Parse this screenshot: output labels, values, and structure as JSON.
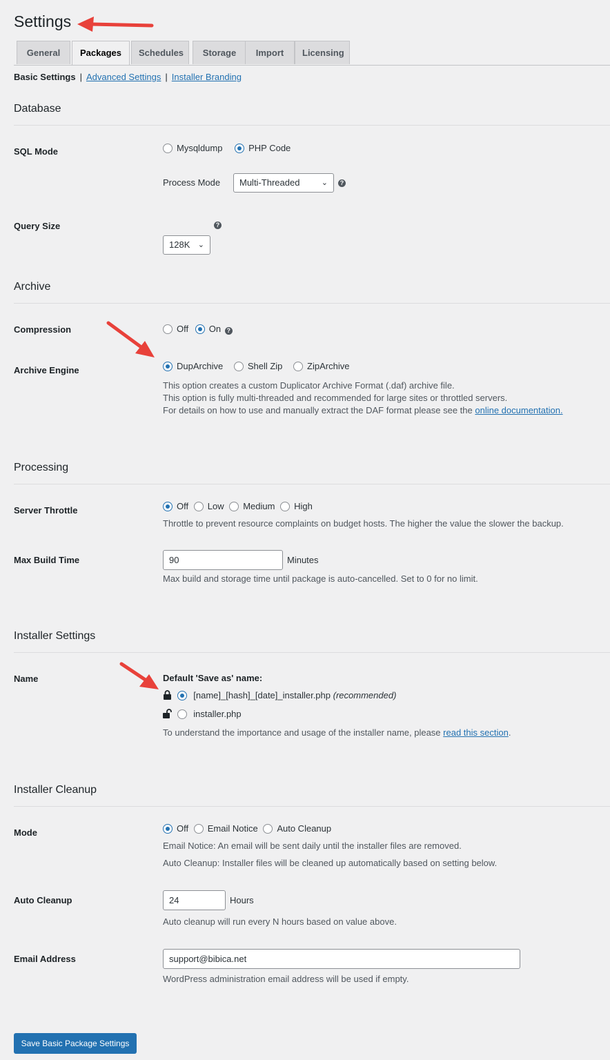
{
  "page_title": "Settings",
  "tabs": [
    {
      "label": "General"
    },
    {
      "label": "Packages"
    },
    {
      "label": "Schedules"
    },
    {
      "label": "Storage"
    },
    {
      "label": "Import"
    },
    {
      "label": "Licensing"
    }
  ],
  "subnav": {
    "current": "Basic Settings",
    "advanced": "Advanced Settings",
    "branding": "Installer Branding",
    "separator": "|"
  },
  "database": {
    "title": "Database",
    "sql_mode_label": "SQL Mode",
    "sql_mode_options": [
      "Mysqldump",
      "PHP Code"
    ],
    "process_mode_label": "Process Mode",
    "process_mode_value": "Multi-Threaded",
    "query_size_label": "Query Size",
    "query_size_value": "128K"
  },
  "archive": {
    "title": "Archive",
    "compression_label": "Compression",
    "compression_options": [
      "Off",
      "On"
    ],
    "engine_label": "Archive Engine",
    "engine_options": [
      "DupArchive",
      "Shell Zip",
      "ZipArchive"
    ],
    "desc1": "This option creates a custom Duplicator Archive Format (.daf) archive file.",
    "desc2": "This option is fully multi-threaded and recommended for large sites or throttled servers.",
    "desc3": "For details on how to use and manually extract the DAF format please see the",
    "desc3_link": "online documentation."
  },
  "processing": {
    "title": "Processing",
    "throttle_label": "Server Throttle",
    "throttle_options": [
      "Off",
      "Low",
      "Medium",
      "High"
    ],
    "throttle_desc": "Throttle to prevent resource complaints on budget hosts. The higher the value the slower the backup.",
    "build_time_label": "Max Build Time",
    "build_time_value": "90",
    "build_time_unit": "Minutes",
    "build_time_desc": "Max build and storage time until package is auto-cancelled. Set to 0 for no limit."
  },
  "installer": {
    "title": "Installer Settings",
    "name_label": "Name",
    "default_name_heading": "Default 'Save as' name:",
    "option1": "[name]_[hash]_[date]_installer.php",
    "option1_note": "(recommended)",
    "option2": "installer.php",
    "desc": "To understand the importance and usage of the installer name, please",
    "desc_link": "read this section",
    "desc_end": "."
  },
  "cleanup": {
    "title": "Installer Cleanup",
    "mode_label": "Mode",
    "mode_options": [
      "Off",
      "Email Notice",
      "Auto Cleanup"
    ],
    "mode_desc1": "Email Notice: An email will be sent daily until the installer files are removed.",
    "mode_desc2": "Auto Cleanup: Installer files will be cleaned up automatically based on setting below.",
    "auto_label": "Auto Cleanup",
    "auto_value": "24",
    "auto_unit": "Hours",
    "auto_desc": "Auto cleanup will run every N hours based on value above.",
    "email_label": "Email Address",
    "email_value": "support@bibica.net",
    "email_desc": "WordPress administration email address will be used if empty."
  },
  "save_button": "Save Basic Package Settings",
  "colors": {
    "accent": "#2271b1",
    "annotation_arrow": "#e8413a"
  }
}
